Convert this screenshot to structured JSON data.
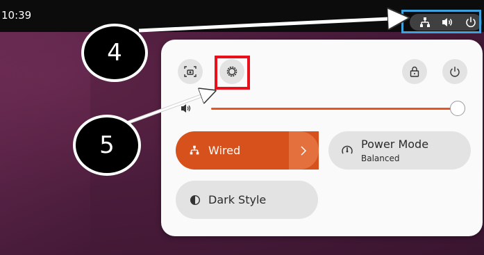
{
  "topbar": {
    "clock": "10:39",
    "tray_icons": [
      "network-wired-icon",
      "volume-icon",
      "power-icon"
    ]
  },
  "quick_settings": {
    "top_buttons": [
      "screenshot-icon",
      "settings-gear-icon",
      "lock-icon",
      "power-icon"
    ],
    "volume_level": 1.0,
    "wired": {
      "label": "Wired"
    },
    "power_mode": {
      "title": "Power Mode",
      "subtitle": "Balanced"
    },
    "dark_style": {
      "label": "Dark Style"
    }
  },
  "annotations": {
    "callout_4": "4",
    "callout_5": "5",
    "highlight_color": "#e8101b",
    "tray_highlight_color": "#3ea2dd"
  },
  "colors": {
    "accent": "#e95420",
    "wired_bg": "#d6511b"
  }
}
